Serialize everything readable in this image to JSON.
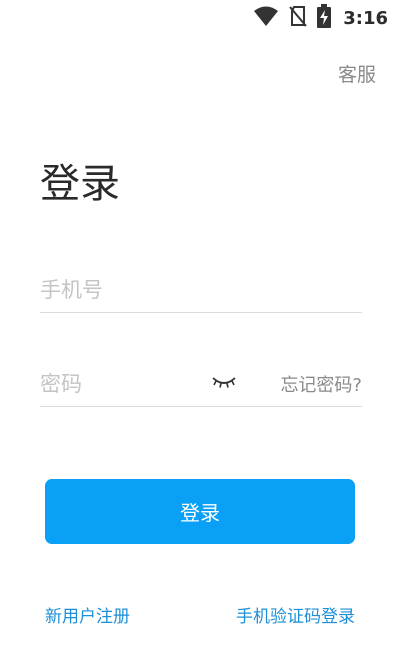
{
  "status_bar": {
    "time": "3:16",
    "icons": [
      "wifi-icon",
      "no-sim-icon",
      "battery-charging-icon"
    ]
  },
  "header": {
    "support_label": "客服"
  },
  "page": {
    "title": "登录"
  },
  "form": {
    "phone_placeholder": "手机号",
    "password_placeholder": "密码",
    "password_visibility_icon": "eye-closed-icon",
    "forgot_label": "忘记密码?",
    "submit_label": "登录"
  },
  "footer": {
    "register_label": "新用户注册",
    "sms_login_label": "手机验证码登录"
  },
  "colors": {
    "accent": "#0aa0f6",
    "link": "#1d8fd8",
    "muted": "#8a8a8a",
    "placeholder": "#c4c4c4",
    "divider": "#dcdcdc"
  }
}
